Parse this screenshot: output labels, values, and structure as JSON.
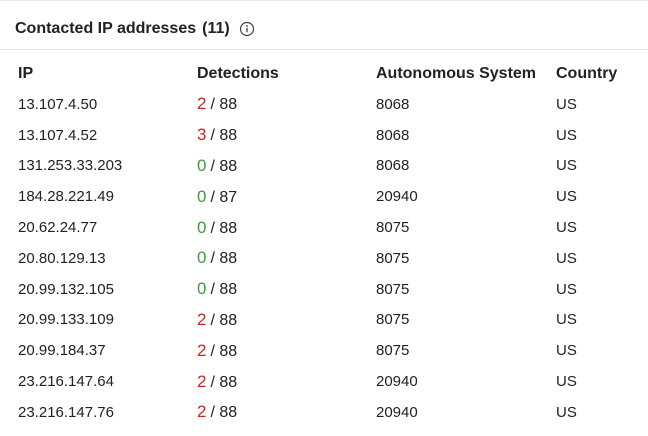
{
  "section": {
    "title": "Contacted IP addresses",
    "count": "(11)",
    "info_icon": "info-icon"
  },
  "columns": {
    "ip": "IP",
    "detections": "Detections",
    "as": "Autonomous System",
    "country": "Country"
  },
  "colors": {
    "detected": "#c62828",
    "clean": "#3d9a3d"
  },
  "rows": [
    {
      "ip": "13.107.4.50",
      "det": "2",
      "det_sep": "/ 88",
      "det_status": "detected",
      "as": "8068",
      "country": "US"
    },
    {
      "ip": "13.107.4.52",
      "det": "3",
      "det_sep": "/ 88",
      "det_status": "detected",
      "as": "8068",
      "country": "US"
    },
    {
      "ip": "131.253.33.203",
      "det": "0",
      "det_sep": "/ 88",
      "det_status": "clean",
      "as": "8068",
      "country": "US"
    },
    {
      "ip": "184.28.221.49",
      "det": "0",
      "det_sep": "/ 87",
      "det_status": "clean",
      "as": "20940",
      "country": "US"
    },
    {
      "ip": "20.62.24.77",
      "det": "0",
      "det_sep": "/ 88",
      "det_status": "clean",
      "as": "8075",
      "country": "US"
    },
    {
      "ip": "20.80.129.13",
      "det": "0",
      "det_sep": "/ 88",
      "det_status": "clean",
      "as": "8075",
      "country": "US"
    },
    {
      "ip": "20.99.132.105",
      "det": "0",
      "det_sep": "/ 88",
      "det_status": "clean",
      "as": "8075",
      "country": "US"
    },
    {
      "ip": "20.99.133.109",
      "det": "2",
      "det_sep": "/ 88",
      "det_status": "detected",
      "as": "8075",
      "country": "US"
    },
    {
      "ip": "20.99.184.37",
      "det": "2",
      "det_sep": "/ 88",
      "det_status": "detected",
      "as": "8075",
      "country": "US"
    },
    {
      "ip": "23.216.147.64",
      "det": "2",
      "det_sep": "/ 88",
      "det_status": "detected",
      "as": "20940",
      "country": "US"
    },
    {
      "ip": "23.216.147.76",
      "det": "2",
      "det_sep": "/ 88",
      "det_status": "detected",
      "as": "20940",
      "country": "US"
    }
  ]
}
